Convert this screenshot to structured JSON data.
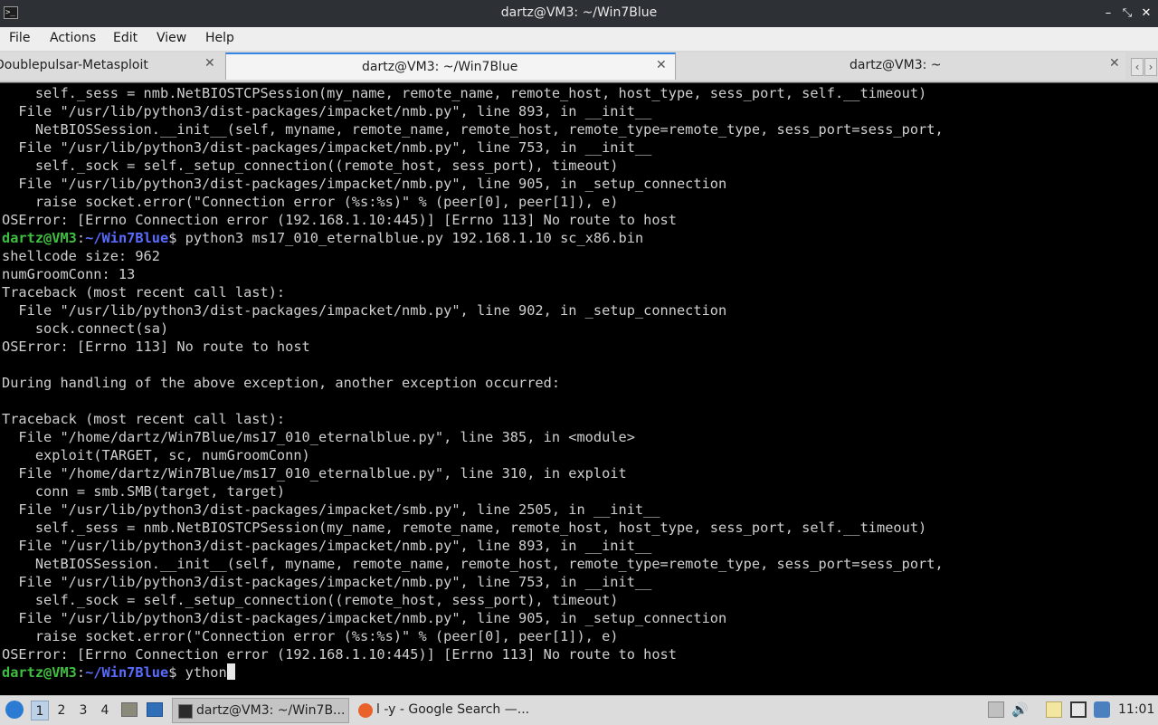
{
  "window": {
    "title": "dartz@VM3: ~/Win7Blue",
    "controls": [
      "–",
      "⤡",
      "✕"
    ]
  },
  "menubar": {
    "items": [
      "File",
      "Actions",
      "Edit",
      "View",
      "Help"
    ]
  },
  "tabs": [
    {
      "label": "Doublepulsar-Metasploit",
      "active": false
    },
    {
      "label": "dartz@VM3: ~/Win7Blue",
      "active": true
    },
    {
      "label": "dartz@VM3: ~",
      "active": false
    }
  ],
  "terminal": {
    "prompt": {
      "user_host": "dartz@VM3",
      "sep": ":",
      "path": "~/Win7Blue",
      "sign": "$ "
    },
    "lines": [
      {
        "text": "    self._sess = nmb.NetBIOSTCPSession(my_name, remote_name, remote_host, host_type, sess_port, self.__timeout)"
      },
      {
        "text": "  File \"/usr/lib/python3/dist-packages/impacket/nmb.py\", line 893, in __init__"
      },
      {
        "text": "    NetBIOSSession.__init__(self, myname, remote_name, remote_host, remote_type=remote_type, sess_port=sess_port,"
      },
      {
        "text": "  File \"/usr/lib/python3/dist-packages/impacket/nmb.py\", line 753, in __init__"
      },
      {
        "text": "    self._sock = self._setup_connection((remote_host, sess_port), timeout)"
      },
      {
        "text": "  File \"/usr/lib/python3/dist-packages/impacket/nmb.py\", line 905, in _setup_connection"
      },
      {
        "text": "    raise socket.error(\"Connection error (%s:%s)\" % (peer[0], peer[1]), e)"
      },
      {
        "text": "OSError: [Errno Connection error (192.168.1.10:445)] [Errno 113] No route to host"
      },
      {
        "prompt": true,
        "text": "python3 ms17_010_eternalblue.py 192.168.1.10 sc_x86.bin"
      },
      {
        "text": "shellcode size: 962"
      },
      {
        "text": "numGroomConn: 13"
      },
      {
        "text": "Traceback (most recent call last):"
      },
      {
        "text": "  File \"/usr/lib/python3/dist-packages/impacket/nmb.py\", line 902, in _setup_connection"
      },
      {
        "text": "    sock.connect(sa)"
      },
      {
        "text": "OSError: [Errno 113] No route to host"
      },
      {
        "text": ""
      },
      {
        "text": "During handling of the above exception, another exception occurred:"
      },
      {
        "text": ""
      },
      {
        "text": "Traceback (most recent call last):"
      },
      {
        "text": "  File \"/home/dartz/Win7Blue/ms17_010_eternalblue.py\", line 385, in <module>"
      },
      {
        "text": "    exploit(TARGET, sc, numGroomConn)"
      },
      {
        "text": "  File \"/home/dartz/Win7Blue/ms17_010_eternalblue.py\", line 310, in exploit"
      },
      {
        "text": "    conn = smb.SMB(target, target)"
      },
      {
        "text": "  File \"/usr/lib/python3/dist-packages/impacket/smb.py\", line 2505, in __init__"
      },
      {
        "text": "    self._sess = nmb.NetBIOSTCPSession(my_name, remote_name, remote_host, host_type, sess_port, self.__timeout)"
      },
      {
        "text": "  File \"/usr/lib/python3/dist-packages/impacket/nmb.py\", line 893, in __init__"
      },
      {
        "text": "    NetBIOSSession.__init__(self, myname, remote_name, remote_host, remote_type=remote_type, sess_port=sess_port,"
      },
      {
        "text": "  File \"/usr/lib/python3/dist-packages/impacket/nmb.py\", line 753, in __init__"
      },
      {
        "text": "    self._sock = self._setup_connection((remote_host, sess_port), timeout)"
      },
      {
        "text": "  File \"/usr/lib/python3/dist-packages/impacket/nmb.py\", line 905, in _setup_connection"
      },
      {
        "text": "    raise socket.error(\"Connection error (%s:%s)\" % (peer[0], peer[1]), e)"
      },
      {
        "text": "OSError: [Errno Connection error (192.168.1.10:445)] [Errno 113] No route to host"
      },
      {
        "prompt": true,
        "text": "ython",
        "cursor": true
      }
    ],
    "colors": {
      "user_host": "#3fbf3f",
      "path": "#5a6cff",
      "text": "#cfcfcf",
      "background": "#000000"
    }
  },
  "taskbar": {
    "workspaces": [
      "1",
      "2",
      "3",
      "4"
    ],
    "current_workspace": "1",
    "tasks": [
      {
        "label": "dartz@VM3: ~/Win7B...",
        "icon": "terminal-icon",
        "active": true
      },
      {
        "label": "l -y - Google Search —...",
        "icon": "firefox-icon",
        "active": false
      }
    ],
    "clock": "11:01"
  }
}
